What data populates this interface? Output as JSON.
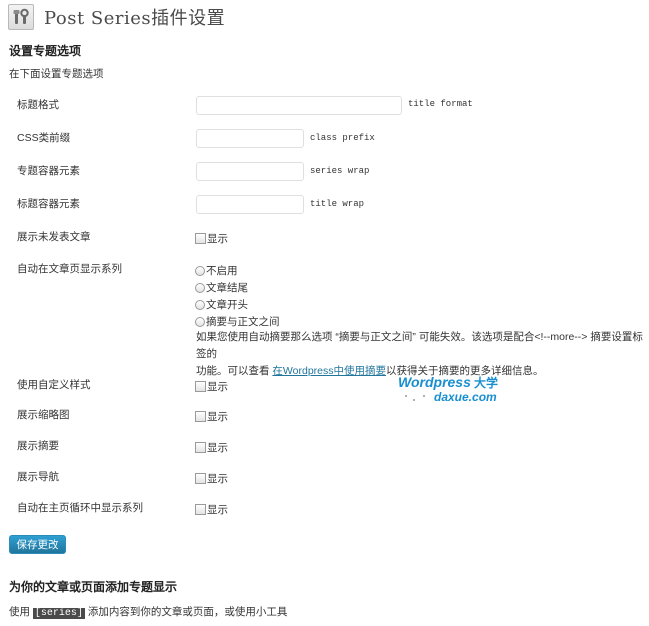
{
  "header": {
    "title": "Post Series插件设置",
    "icon": "settings-tools-icon"
  },
  "section1": {
    "title": "设置专题选项",
    "intro": "在下面设置专题选项"
  },
  "fields": {
    "title_format": {
      "label": "标题格式",
      "value": "",
      "desc": "title format"
    },
    "class_prefix": {
      "label": "CSS类前缀",
      "value": "",
      "desc": "class prefix"
    },
    "series_wrap": {
      "label": "专题容器元素",
      "value": "",
      "desc": "series wrap"
    },
    "title_wrap": {
      "label": "标题容器元素",
      "value": "",
      "desc": "title wrap"
    }
  },
  "show_unpublished": {
    "label": "展示未发表文章",
    "option": "显示",
    "checked": false
  },
  "auto_display": {
    "label": "自动在文章页显示系列",
    "options": [
      "不启用",
      "文章结尾",
      "文章开头",
      "摘要与正文之间"
    ],
    "help_line1": "如果您使用自动摘要那么选项 “摘要与正文之间” 可能失效。该选项是配合<!--more--> 摘要设置标签的",
    "help_line2_prefix": "功能。可以查看 ",
    "help_link": "在Wordpress中使用摘要",
    "help_line2_suffix": "以获得关于摘要的更多详细信息。"
  },
  "checkbox_rows": [
    {
      "label": "使用自定义样式",
      "option": "显示",
      "checked": false
    },
    {
      "label": "展示缩略图",
      "option": "显示",
      "checked": false
    },
    {
      "label": "展示摘要",
      "option": "显示",
      "checked": false
    },
    {
      "label": "展示导航",
      "option": "显示",
      "checked": false
    },
    {
      "label": "自动在主页循环中显示系列",
      "option": "显示",
      "checked": false
    }
  ],
  "watermark": {
    "line1": "Wordpress大学",
    "line2": "daxue.com"
  },
  "save_button": "保存更改",
  "section2": {
    "title": "为你的文章或页面添加专题显示",
    "text_prefix": "使用 ",
    "code": "[series]",
    "text_suffix": " 添加内容到你的文章或页面，或使用小工具"
  },
  "colors": {
    "accent": "#21759b",
    "button": "#2e9fd2",
    "watermark_blue": "#1a8fd0"
  }
}
